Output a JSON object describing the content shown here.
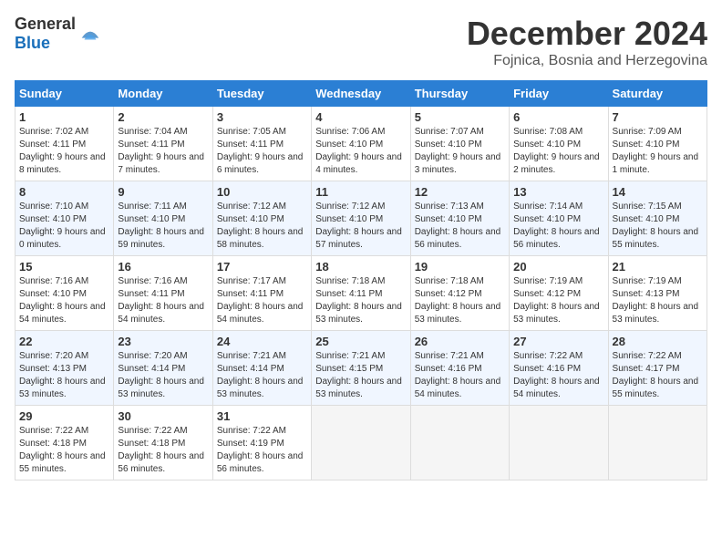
{
  "header": {
    "logo_general": "General",
    "logo_blue": "Blue",
    "month": "December 2024",
    "location": "Fojnica, Bosnia and Herzegovina"
  },
  "days_of_week": [
    "Sunday",
    "Monday",
    "Tuesday",
    "Wednesday",
    "Thursday",
    "Friday",
    "Saturday"
  ],
  "weeks": [
    [
      {
        "num": "1",
        "rise": "7:02 AM",
        "set": "4:11 PM",
        "daylight": "9 hours and 8 minutes."
      },
      {
        "num": "2",
        "rise": "7:04 AM",
        "set": "4:11 PM",
        "daylight": "9 hours and 7 minutes."
      },
      {
        "num": "3",
        "rise": "7:05 AM",
        "set": "4:11 PM",
        "daylight": "9 hours and 6 minutes."
      },
      {
        "num": "4",
        "rise": "7:06 AM",
        "set": "4:10 PM",
        "daylight": "9 hours and 4 minutes."
      },
      {
        "num": "5",
        "rise": "7:07 AM",
        "set": "4:10 PM",
        "daylight": "9 hours and 3 minutes."
      },
      {
        "num": "6",
        "rise": "7:08 AM",
        "set": "4:10 PM",
        "daylight": "9 hours and 2 minutes."
      },
      {
        "num": "7",
        "rise": "7:09 AM",
        "set": "4:10 PM",
        "daylight": "9 hours and 1 minute."
      }
    ],
    [
      {
        "num": "8",
        "rise": "7:10 AM",
        "set": "4:10 PM",
        "daylight": "9 hours and 0 minutes."
      },
      {
        "num": "9",
        "rise": "7:11 AM",
        "set": "4:10 PM",
        "daylight": "8 hours and 59 minutes."
      },
      {
        "num": "10",
        "rise": "7:12 AM",
        "set": "4:10 PM",
        "daylight": "8 hours and 58 minutes."
      },
      {
        "num": "11",
        "rise": "7:12 AM",
        "set": "4:10 PM",
        "daylight": "8 hours and 57 minutes."
      },
      {
        "num": "12",
        "rise": "7:13 AM",
        "set": "4:10 PM",
        "daylight": "8 hours and 56 minutes."
      },
      {
        "num": "13",
        "rise": "7:14 AM",
        "set": "4:10 PM",
        "daylight": "8 hours and 56 minutes."
      },
      {
        "num": "14",
        "rise": "7:15 AM",
        "set": "4:10 PM",
        "daylight": "8 hours and 55 minutes."
      }
    ],
    [
      {
        "num": "15",
        "rise": "7:16 AM",
        "set": "4:10 PM",
        "daylight": "8 hours and 54 minutes."
      },
      {
        "num": "16",
        "rise": "7:16 AM",
        "set": "4:11 PM",
        "daylight": "8 hours and 54 minutes."
      },
      {
        "num": "17",
        "rise": "7:17 AM",
        "set": "4:11 PM",
        "daylight": "8 hours and 54 minutes."
      },
      {
        "num": "18",
        "rise": "7:18 AM",
        "set": "4:11 PM",
        "daylight": "8 hours and 53 minutes."
      },
      {
        "num": "19",
        "rise": "7:18 AM",
        "set": "4:12 PM",
        "daylight": "8 hours and 53 minutes."
      },
      {
        "num": "20",
        "rise": "7:19 AM",
        "set": "4:12 PM",
        "daylight": "8 hours and 53 minutes."
      },
      {
        "num": "21",
        "rise": "7:19 AM",
        "set": "4:13 PM",
        "daylight": "8 hours and 53 minutes."
      }
    ],
    [
      {
        "num": "22",
        "rise": "7:20 AM",
        "set": "4:13 PM",
        "daylight": "8 hours and 53 minutes."
      },
      {
        "num": "23",
        "rise": "7:20 AM",
        "set": "4:14 PM",
        "daylight": "8 hours and 53 minutes."
      },
      {
        "num": "24",
        "rise": "7:21 AM",
        "set": "4:14 PM",
        "daylight": "8 hours and 53 minutes."
      },
      {
        "num": "25",
        "rise": "7:21 AM",
        "set": "4:15 PM",
        "daylight": "8 hours and 53 minutes."
      },
      {
        "num": "26",
        "rise": "7:21 AM",
        "set": "4:16 PM",
        "daylight": "8 hours and 54 minutes."
      },
      {
        "num": "27",
        "rise": "7:22 AM",
        "set": "4:16 PM",
        "daylight": "8 hours and 54 minutes."
      },
      {
        "num": "28",
        "rise": "7:22 AM",
        "set": "4:17 PM",
        "daylight": "8 hours and 55 minutes."
      }
    ],
    [
      {
        "num": "29",
        "rise": "7:22 AM",
        "set": "4:18 PM",
        "daylight": "8 hours and 55 minutes."
      },
      {
        "num": "30",
        "rise": "7:22 AM",
        "set": "4:18 PM",
        "daylight": "8 hours and 56 minutes."
      },
      {
        "num": "31",
        "rise": "7:22 AM",
        "set": "4:19 PM",
        "daylight": "8 hours and 56 minutes."
      },
      null,
      null,
      null,
      null
    ]
  ],
  "labels": {
    "sunrise": "Sunrise:",
    "sunset": "Sunset:",
    "daylight": "Daylight:"
  }
}
